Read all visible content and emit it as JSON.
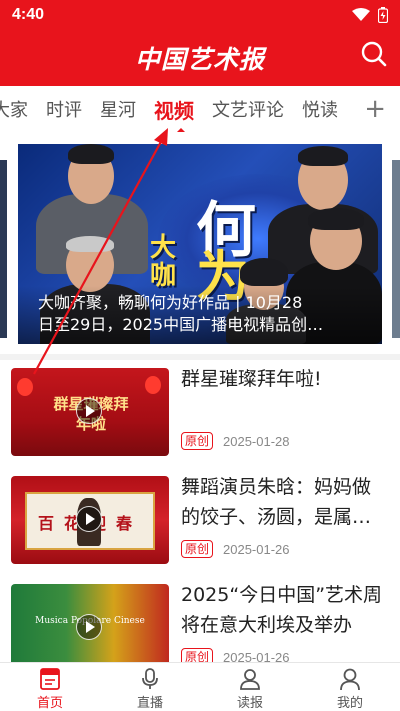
{
  "status_bar": {
    "time": "4:40"
  },
  "header": {
    "title": "中国艺术报"
  },
  "tabs": [
    {
      "label": "大家"
    },
    {
      "label": "时评"
    },
    {
      "label": "星河"
    },
    {
      "label": "视频"
    },
    {
      "label": "文艺评论"
    },
    {
      "label": "悦读"
    }
  ],
  "tab_add": "+",
  "carousel": {
    "caption_line1": "大咖齐聚，畅聊何为好作品 | 10月28",
    "caption_line2": "日至29日，2025中国广播电视精品创…",
    "art_text": {
      "c1": "何",
      "c2": "为",
      "c3": "大咖"
    }
  },
  "feed": [
    {
      "title": "群星璀璨拜年啦!",
      "badge": "原创",
      "date": "2025-01-28",
      "thumb_text": "群星璀璨拜年啦"
    },
    {
      "title": "舞蹈演员朱晗：妈妈做的饺子、汤圆，是属…",
      "badge": "原创",
      "date": "2025-01-26",
      "thumb_text": "百花迎春"
    },
    {
      "title": "2025“今日中国”艺术周将在意大利埃及举办",
      "badge": "原创",
      "date": "2025-01-26",
      "thumb_text": "Musica Popolare Cinese"
    }
  ],
  "bottom_nav": [
    {
      "label": "首页",
      "icon": "news-icon",
      "active": true
    },
    {
      "label": "直播",
      "icon": "microphone-icon",
      "active": false
    },
    {
      "label": "读报",
      "icon": "reader-icon",
      "active": false
    },
    {
      "label": "我的",
      "icon": "profile-icon",
      "active": false
    }
  ],
  "colors": {
    "brand_red": "#e8141c",
    "text": "#222222",
    "muted": "#888888"
  }
}
